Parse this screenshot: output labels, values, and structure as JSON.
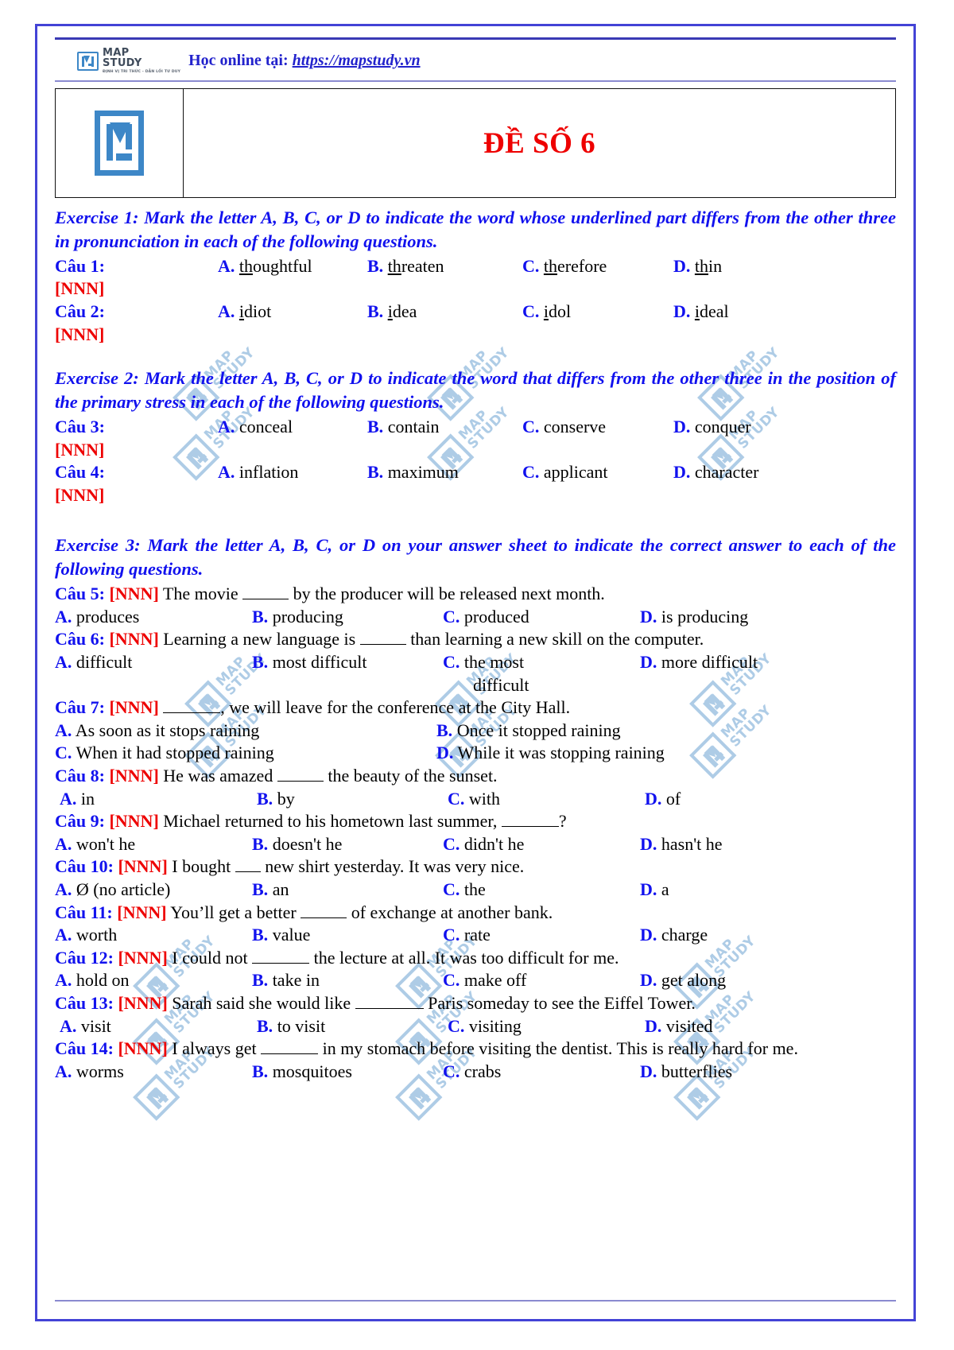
{
  "brand": {
    "logo_words_line1": "MAP",
    "logo_words_line2": "STUDY",
    "logo_tagline": "ĐỊNH VỊ TRI THỨC - DẪN LỐI TƯ DUY",
    "prefix": "Học online tại: ",
    "url": "https://mapstudy.vn",
    "logo_icon": "mapstudy-m-logo"
  },
  "header": {
    "exam_title": "ĐỀ SỐ 6",
    "logo_icon": "mapstudy-m-logo-large"
  },
  "watermark": {
    "line1": "MAP",
    "line2": "STUDY"
  },
  "exercises": [
    {
      "id": "exercise-1",
      "instruction": "Exercise 1: Mark the letter A, B, C, or D to indicate the word whose underlined part differs from the other three in pronunciation in each of the following questions.",
      "questions": [
        {
          "label": "Câu 1:",
          "answer": "[NNN]",
          "options": [
            {
              "letter": "A.",
              "pre": "",
              "under": "th",
              "post": "oughtful"
            },
            {
              "letter": "B.",
              "pre": "",
              "under": "th",
              "post": "reaten"
            },
            {
              "letter": "C.",
              "pre": "",
              "under": "th",
              "post": "erefore"
            },
            {
              "letter": "D.",
              "pre": "",
              "under": "th",
              "post": "in"
            }
          ]
        },
        {
          "label": "Câu 2:",
          "answer": "[NNN]",
          "options": [
            {
              "letter": "A.",
              "pre": "",
              "under": "i",
              "post": "diot"
            },
            {
              "letter": "B.",
              "pre": "",
              "under": "i",
              "post": "dea"
            },
            {
              "letter": "C.",
              "pre": "",
              "under": "i",
              "post": "dol"
            },
            {
              "letter": "D.",
              "pre": "",
              "under": "i",
              "post": "deal"
            }
          ]
        }
      ]
    },
    {
      "id": "exercise-2",
      "instruction": "Exercise 2: Mark the letter A, B, C, or D to indicate the word that differs from the other three in the position of the primary stress in each of the following questions.",
      "questions": [
        {
          "label": "Câu 3:",
          "answer": "[NNN]",
          "options": [
            {
              "letter": "A.",
              "text": "conceal"
            },
            {
              "letter": "B.",
              "text": "contain"
            },
            {
              "letter": "C.",
              "text": "conserve"
            },
            {
              "letter": "D.",
              "text": "conquer"
            }
          ]
        },
        {
          "label": "Câu 4:",
          "answer": "[NNN]",
          "options": [
            {
              "letter": "A.",
              "text": "inflation"
            },
            {
              "letter": "B.",
              "text": "maximum"
            },
            {
              "letter": "C.",
              "text": "applicant"
            },
            {
              "letter": "D.",
              "text": "character"
            }
          ]
        }
      ]
    }
  ],
  "exercise3": {
    "id": "exercise-3",
    "instruction": "Exercise 3: Mark the letter A, B, C, or D on your answer sheet to indicate the correct answer to each of the following questions."
  },
  "q5": {
    "label": "Câu 5:",
    "answer": "[NNN]",
    "stem_a": "The movie ",
    "stem_b": " by the producer will be released next month.",
    "opt_a_letter": "A.",
    "opt_a": "produces",
    "opt_b_letter": "B.",
    "opt_b": "producing",
    "opt_c_letter": "C.",
    "opt_c": "produced",
    "opt_d_letter": "D.",
    "opt_d": "is producing"
  },
  "q6": {
    "label": "Câu 6:",
    "answer": "[NNN]",
    "stem_a": "Learning a new language is ",
    "stem_b": " than learning a new skill on the computer.",
    "opt_a_letter": "A.",
    "opt_a": "difficult",
    "opt_b_letter": "B.",
    "opt_b": "most difficult",
    "opt_c_letter": "C.",
    "opt_c": "the most",
    "opt_c2": "difficult",
    "opt_d_letter": "D.",
    "opt_d": "more difficult"
  },
  "q7": {
    "label": "Câu 7:",
    "answer": "[NNN]",
    "stem_a": "",
    "stem_b": ", we will leave for the conference at the City Hall.",
    "opt_a_letter": "A.",
    "opt_a": "As soon as it stops raining",
    "opt_b_letter": "B.",
    "opt_b": "Once it stopped raining",
    "opt_c_letter": "C.",
    "opt_c": "When it had stopped raining",
    "opt_d_letter": "D.",
    "opt_d": "While it was stopping raining"
  },
  "q8": {
    "label": "Câu 8:",
    "answer": "[NNN]",
    "stem_a": "He was amazed ",
    "stem_b": " the beauty of the sunset.",
    "opt_a_letter": "A.",
    "opt_a": "in",
    "opt_b_letter": "B.",
    "opt_b": "by",
    "opt_c_letter": "C.",
    "opt_c": "with",
    "opt_d_letter": "D.",
    "opt_d": "of"
  },
  "q9": {
    "label": "Câu 9:",
    "answer": "[NNN]",
    "stem_a": "Michael returned to his hometown last summer, ",
    "stem_b": "?",
    "opt_a_letter": "A.",
    "opt_a": "won't he",
    "opt_b_letter": "B.",
    "opt_b": "doesn't he",
    "opt_c_letter": "C.",
    "opt_c": "didn't he",
    "opt_d_letter": "D.",
    "opt_d": "hasn't he"
  },
  "q10": {
    "label": "Câu 10:",
    "answer": "[NNN]",
    "stem_a": "I bought ",
    "stem_b": " new shirt yesterday. It was very nice.",
    "opt_a_letter": "A.",
    "opt_a": "Ø (no article)",
    "opt_b_letter": "B.",
    "opt_b": "an",
    "opt_c_letter": "C.",
    "opt_c": "the",
    "opt_d_letter": "D.",
    "opt_d": "a"
  },
  "q11": {
    "label": "Câu 11:",
    "answer": "[NNN]",
    "stem_a": "You’ll get a better ",
    "stem_b": " of exchange at another bank.",
    "opt_a_letter": "A.",
    "opt_a": "worth",
    "opt_b_letter": "B.",
    "opt_b": "value",
    "opt_c_letter": "C.",
    "opt_c": "rate",
    "opt_d_letter": "D.",
    "opt_d": "charge"
  },
  "q12": {
    "label": "Câu 12:",
    "answer": "[NNN]",
    "stem_a": "I could not ",
    "stem_b": " the lecture at all. It was too difficult for me.",
    "opt_a_letter": "A.",
    "opt_a": "hold on",
    "opt_b_letter": "B.",
    "opt_b": "take in",
    "opt_c_letter": "C.",
    "opt_c": "make off",
    "opt_d_letter": "D.",
    "opt_d": "get along"
  },
  "q13": {
    "label": "Câu 13:",
    "answer": "[NNN]",
    "stem_a": "Sarah said she would like ",
    "stem_b": " Paris someday to see the Eiffel Tower.",
    "opt_a_letter": "A.",
    "opt_a": "visit",
    "opt_b_letter": "B.",
    "opt_b": "to visit",
    "opt_c_letter": "C.",
    "opt_c": "visiting",
    "opt_d_letter": "D.",
    "opt_d": "visited"
  },
  "q14": {
    "label": "Câu 14:",
    "answer": "[NNN]",
    "stem_a": "I always get ",
    "stem_b": " in my stomach before visiting the dentist. This is really hard for me.",
    "opt_a_letter": "A.",
    "opt_a": "worms",
    "opt_b_letter": "B.",
    "opt_b": "mosquitoes",
    "opt_c_letter": "C.",
    "opt_c": "crabs",
    "opt_d_letter": "D.",
    "opt_d": "butterflies"
  },
  "colors": {
    "frame": "#4343d6",
    "instruction_blue": "#1111ee",
    "answer_red": "#ee0000",
    "title_red": "#ee0000",
    "logo_blue": "#3d87c7",
    "watermark": "#8fb9dd"
  }
}
